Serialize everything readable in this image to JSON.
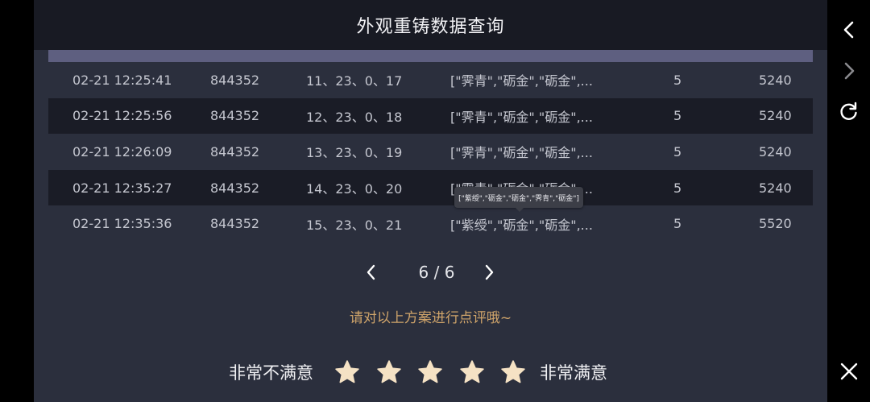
{
  "header": {
    "title": "外观重铸数据查询"
  },
  "table": {
    "rows": [
      {
        "time": "02-21 12:25:41",
        "id": "844352",
        "nums": "11、23、0、17",
        "items": "[\"霁青\",\"砺金\",\"砺金\",...",
        "count": "5",
        "price": "5240"
      },
      {
        "time": "02-21 12:25:56",
        "id": "844352",
        "nums": "12、23、0、18",
        "items": "[\"霁青\",\"砺金\",\"砺金\",...",
        "count": "5",
        "price": "5240"
      },
      {
        "time": "02-21 12:26:09",
        "id": "844352",
        "nums": "13、23、0、19",
        "items": "[\"霁青\",\"砺金\",\"砺金\",...",
        "count": "5",
        "price": "5240"
      },
      {
        "time": "02-21 12:35:27",
        "id": "844352",
        "nums": "14、23、0、20",
        "items": "[\"霁青\",\"砺金\",\"砺金\",...",
        "count": "5",
        "price": "5240"
      },
      {
        "time": "02-21 12:35:36",
        "id": "844352",
        "nums": "15、23、0、21",
        "items": "[\"紫绶\",\"砺金\",\"砺金\",...",
        "count": "5",
        "price": "5520"
      }
    ]
  },
  "tooltip": {
    "text": "[\"紫绶\",\"砺金\",\"砺金\",\"霁青\",\"砺金\"]"
  },
  "pagination": {
    "current": "6",
    "total": "6",
    "label": "6 / 6"
  },
  "feedback": {
    "prompt": "请对以上方案进行点评哦~",
    "low_label": "非常不满意",
    "high_label": "非常满意",
    "stars": 5,
    "star_color": "#f5e2c4"
  },
  "colors": {
    "accent": "#cfa46a",
    "header_bg": "#181a23",
    "panel_bg": "#2b2f3d",
    "row_dark": "#1a1c26",
    "table_header": "#5e5f80"
  },
  "nav": {
    "icons": [
      "chevron-left-icon",
      "chevron-right-icon",
      "refresh-icon",
      "close-icon"
    ]
  }
}
